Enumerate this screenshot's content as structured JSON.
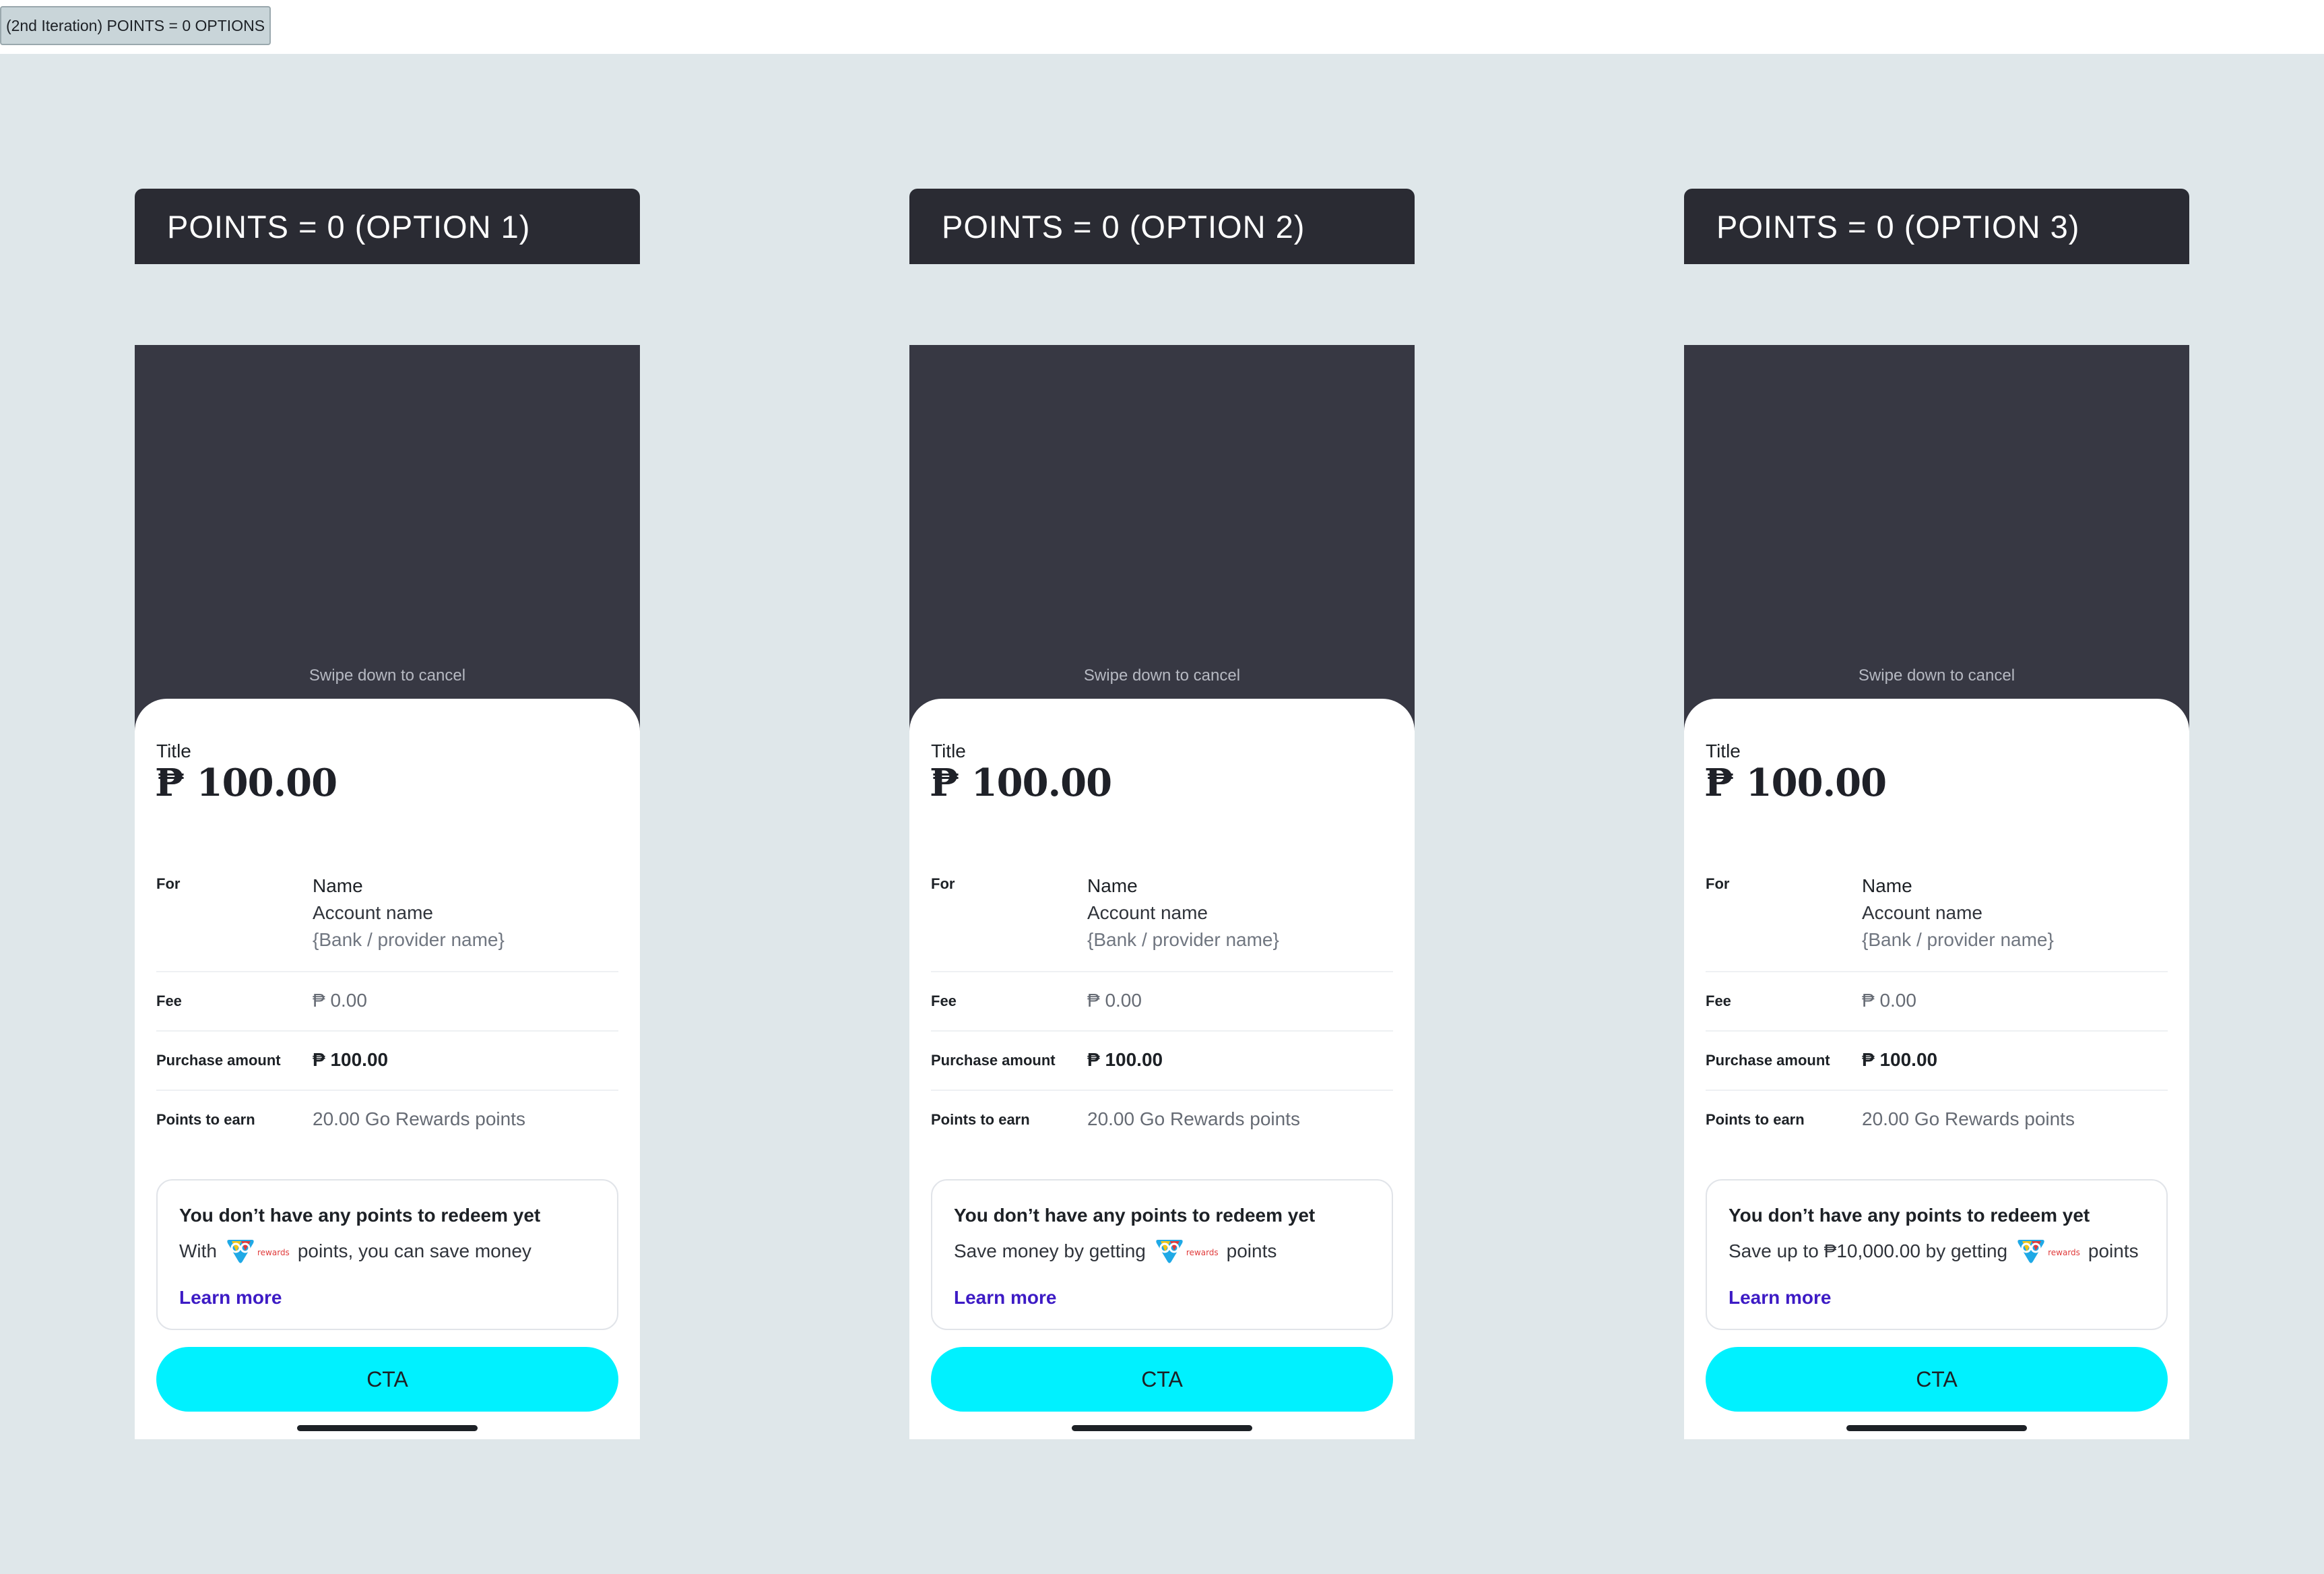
{
  "frame_label": "(2nd Iteration) POINTS = 0 OPTIONS",
  "colors": {
    "canvas": "#dfe7ea",
    "header_bg": "#2a2b33",
    "overlay": "#373843",
    "cta": "#00f1ff",
    "link": "#3d1bc5"
  },
  "options": [
    {
      "header": "POINTS = 0 (OPTION 1)",
      "swipe_hint": "Swipe down to cancel",
      "title": "Title",
      "amount": "₱ 100.00",
      "for_label": "For",
      "for_name": "Name",
      "for_account": "Account name",
      "for_bank": "{Bank / provider name}",
      "fee_label": "Fee",
      "fee_value": "₱ 0.00",
      "purchase_label": "Purchase amount",
      "purchase_value": "₱ 100.00",
      "points_label": "Points to earn",
      "points_value": "20.00 Go Rewards points",
      "info_title": "You don’t have any points to redeem yet",
      "info_before_logo": "With",
      "info_after_logo": "points, you can save money",
      "learn_more": "Learn more",
      "cta": "CTA"
    },
    {
      "header": "POINTS = 0 (OPTION 2)",
      "swipe_hint": "Swipe down to cancel",
      "title": "Title",
      "amount": "₱ 100.00",
      "for_label": "For",
      "for_name": "Name",
      "for_account": "Account name",
      "for_bank": "{Bank / provider name}",
      "fee_label": "Fee",
      "fee_value": "₱ 0.00",
      "purchase_label": "Purchase amount",
      "purchase_value": "₱ 100.00",
      "points_label": "Points to earn",
      "points_value": "20.00 Go Rewards points",
      "info_title": "You don’t have any points to redeem yet",
      "info_before_logo": "Save money by getting",
      "info_after_logo": "points",
      "learn_more": "Learn more",
      "cta": "CTA"
    },
    {
      "header": "POINTS = 0 (OPTION 3)",
      "swipe_hint": "Swipe down to cancel",
      "title": "Title",
      "amount": "₱ 100.00",
      "for_label": "For",
      "for_name": "Name",
      "for_account": "Account name",
      "for_bank": "{Bank / provider name}",
      "fee_label": "Fee",
      "fee_value": "₱ 0.00",
      "purchase_label": "Purchase amount",
      "purchase_value": "₱ 100.00",
      "points_label": "Points to earn",
      "points_value": "20.00 Go Rewards points",
      "info_title": "You don’t have any points to redeem yet",
      "info_before_logo": "Save up to ₱10,000.00 by getting",
      "info_after_logo": "points",
      "learn_more": "Learn more",
      "cta": "CTA"
    }
  ],
  "logo": {
    "icon": "go-rewards-logo",
    "text": "rewards"
  }
}
